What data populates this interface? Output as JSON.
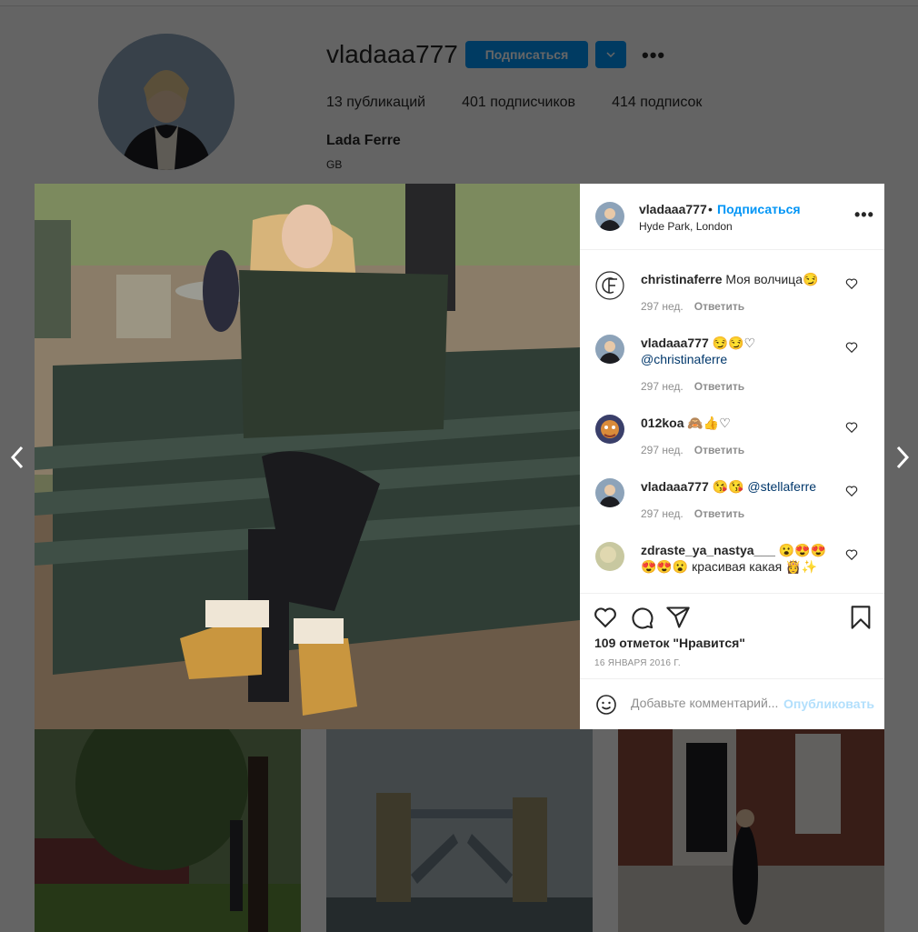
{
  "profile": {
    "username": "vladaaa777",
    "follow_button": "Подписаться",
    "stats": {
      "posts": "13 публикаций",
      "followers": "401 подписчиков",
      "following": "414 подписок"
    },
    "full_name": "Lada Ferre",
    "bio": "GB"
  },
  "post": {
    "author": "vladaaa777",
    "separator": "•",
    "follow_link": "Подписаться",
    "location": "Hyde Park, London",
    "comments": [
      {
        "user": "christinaferre",
        "text": " Моя волчица😏",
        "mention": "",
        "time": "297 нед.",
        "reply": "Ответить"
      },
      {
        "user": "vladaaa777",
        "text": " 😏😏♡ ",
        "mention": "@christinaferre",
        "time": "297 нед.",
        "reply": "Ответить"
      },
      {
        "user": "012koa",
        "text": " 🙈👍♡",
        "mention": "",
        "time": "297 нед.",
        "reply": "Ответить"
      },
      {
        "user": "vladaaa777",
        "text": " 😘😘 ",
        "mention": "@stellaferre",
        "time": "297 нед.",
        "reply": "Ответить"
      },
      {
        "user": "zdraste_ya_nastya___",
        "text": " 😮😍😍😍😍😮 красивая какая 👸✨",
        "mention": "",
        "time": "",
        "reply": ""
      }
    ],
    "likes": "109 отметок \"Нравится\"",
    "date": "16 ЯНВАРЯ 2016 Г.",
    "comment_placeholder": "Добавьте комментарий...",
    "publish_button": "Опубликовать"
  },
  "icons": {
    "heart": "heart-icon",
    "comment": "comment-icon",
    "share": "share-icon",
    "bookmark": "bookmark-icon",
    "emoji": "emoji-icon",
    "prev": "chevron-left-icon",
    "next": "chevron-right-icon",
    "more": "more-options-icon"
  },
  "colors": {
    "accent": "#0095f6",
    "publish_disabled": "#b2dffc",
    "mention": "#00376b",
    "meta": "#8e8e8e"
  }
}
